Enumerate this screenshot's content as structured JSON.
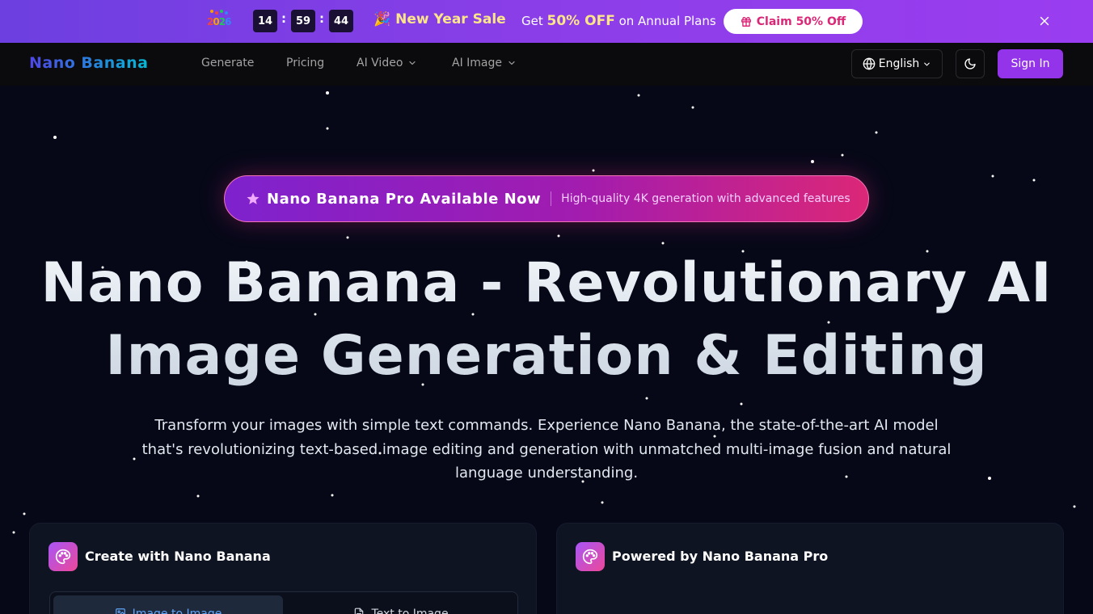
{
  "promo": {
    "year_badge": "2026",
    "countdown": {
      "hours": "14",
      "minutes": "59",
      "seconds": "44",
      "separator": ":"
    },
    "sale_title": "New Year Sale",
    "sale_desc_prefix": "Get",
    "sale_desc_highlight": "50% OFF",
    "sale_desc_suffix": "on Annual Plans",
    "claim_label": "Claim 50% Off",
    "icons": {
      "party": "party-popper-icon",
      "gift": "gift-icon",
      "close": "close-icon"
    }
  },
  "nav": {
    "logo": "Nano Banana",
    "links": [
      {
        "label": "Generate"
      },
      {
        "label": "Pricing"
      },
      {
        "label": "AI Video",
        "dropdown": true
      },
      {
        "label": "AI Image",
        "dropdown": true
      }
    ],
    "language": "English",
    "sign_in": "Sign In"
  },
  "hero": {
    "pill_title": "Nano Banana Pro Available Now",
    "pill_subtitle": "High-quality 4K generation with advanced features",
    "title_line1": "Nano Banana - Revolutionary AI",
    "title_line2": "Image Generation & Editing",
    "description": "Transform your images with simple text commands. Experience Nano Banana, the state-of-the-art AI model that's revolutionizing text-based image editing and generation with unmatched multi-image fusion and natural language understanding."
  },
  "cards": {
    "create": {
      "title": "Create with Nano Banana",
      "tabs": [
        {
          "label": "Image to Image",
          "active": true
        },
        {
          "label": "Text to Image",
          "active": false
        }
      ]
    },
    "powered": {
      "title": "Powered by Nano Banana Pro"
    }
  },
  "colors": {
    "accent": "#9333ea",
    "banner_start": "#6d3fe0",
    "banner_end": "#9a3df0",
    "pill_start": "#7e22ce",
    "pill_end": "#db2777",
    "background": "#060818",
    "tab_active_text": "#60a5fa"
  }
}
